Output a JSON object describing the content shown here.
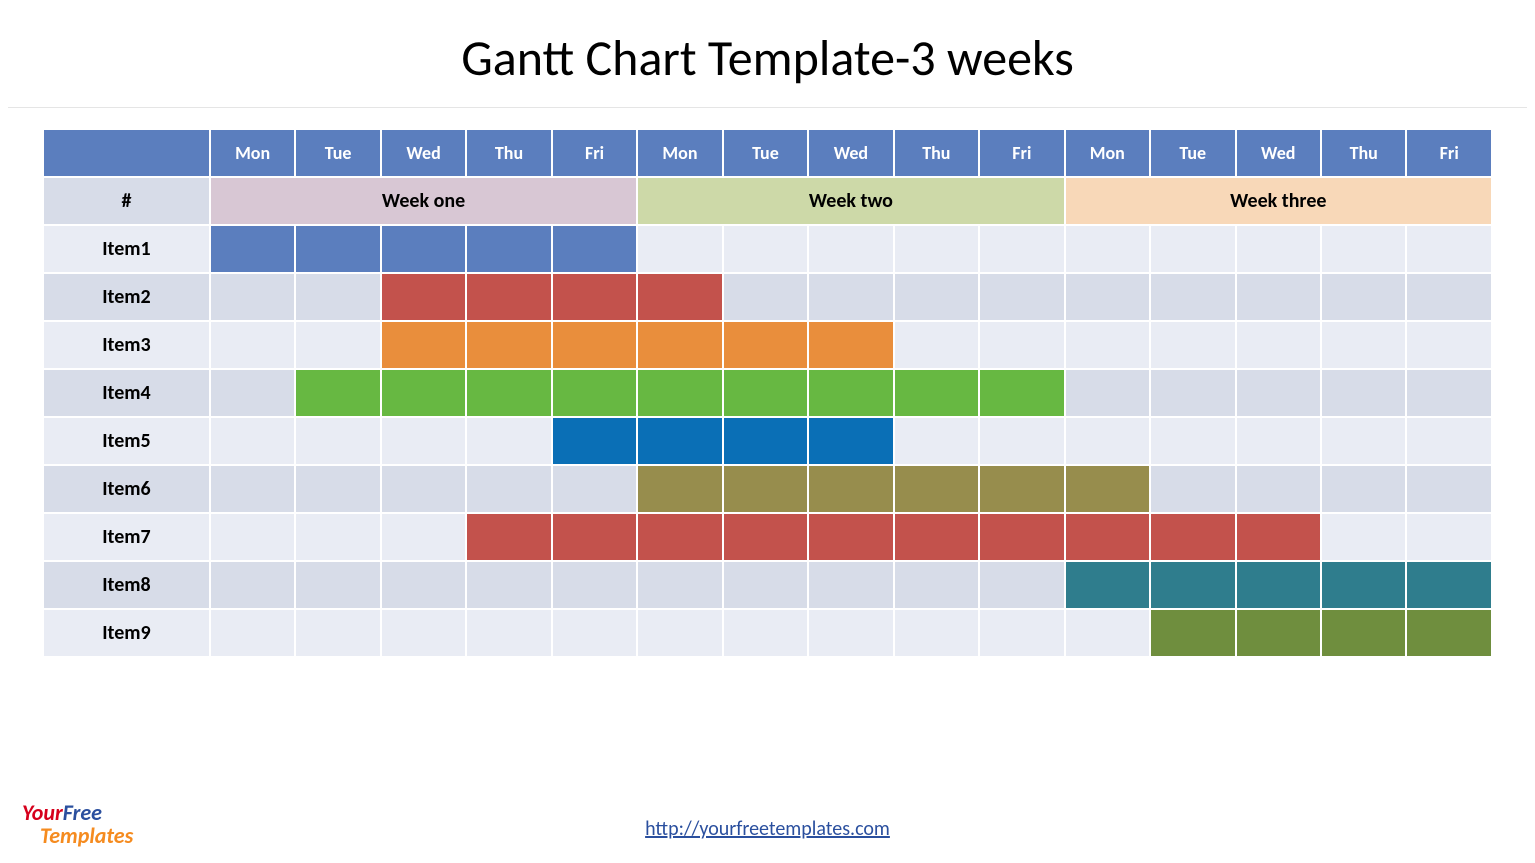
{
  "title": "Gantt Chart Template-3 weeks",
  "index_label": "#",
  "days": [
    "Mon",
    "Tue",
    "Wed",
    "Thu",
    "Fri",
    "Mon",
    "Tue",
    "Wed",
    "Thu",
    "Fri",
    "Mon",
    "Tue",
    "Wed",
    "Thu",
    "Fri"
  ],
  "weeks": [
    {
      "label": "Week one",
      "span": 5,
      "bg": "#d8c7d4"
    },
    {
      "label": "Week two",
      "span": 5,
      "bg": "#cdd9a8"
    },
    {
      "label": "Week three",
      "span": 5,
      "bg": "#f8d8b8"
    }
  ],
  "row_bg": {
    "label_odd": "#e9ecf4",
    "label_even": "#d7dce8",
    "cell_odd": "#e9ecf4",
    "cell_even": "#d7dce8"
  },
  "items": [
    {
      "label": "Item1",
      "start": 0,
      "end": 4,
      "color": "#5b7ebe"
    },
    {
      "label": "Item2",
      "start": 2,
      "end": 5,
      "color": "#c3524c"
    },
    {
      "label": "Item3",
      "start": 2,
      "end": 7,
      "color": "#e98e3c"
    },
    {
      "label": "Item4",
      "start": 1,
      "end": 9,
      "color": "#67b842"
    },
    {
      "label": "Item5",
      "start": 4,
      "end": 7,
      "color": "#0a6fb6"
    },
    {
      "label": "Item6",
      "start": 5,
      "end": 10,
      "color": "#978d4d"
    },
    {
      "label": "Item7",
      "start": 3,
      "end": 12,
      "color": "#c3524c"
    },
    {
      "label": "Item8",
      "start": 10,
      "end": 14,
      "color": "#2f7d8d"
    },
    {
      "label": "Item9",
      "start": 11,
      "end": 14,
      "color": "#6f8e3e"
    }
  ],
  "url_text": "http://yourfreetemplates.com",
  "logo": {
    "part1": "Your",
    "part2": "Free",
    "part3": "Templates"
  },
  "chart_data": {
    "type": "gantt",
    "title": "Gantt Chart Template-3 weeks",
    "categories": [
      "Mon",
      "Tue",
      "Wed",
      "Thu",
      "Fri",
      "Mon",
      "Tue",
      "Wed",
      "Thu",
      "Fri",
      "Mon",
      "Tue",
      "Wed",
      "Thu",
      "Fri"
    ],
    "groups": [
      {
        "label": "Week one",
        "range": [
          0,
          4
        ]
      },
      {
        "label": "Week two",
        "range": [
          5,
          9
        ]
      },
      {
        "label": "Week three",
        "range": [
          10,
          14
        ]
      }
    ],
    "series": [
      {
        "name": "Item1",
        "start": 0,
        "end": 4,
        "color": "#5b7ebe"
      },
      {
        "name": "Item2",
        "start": 2,
        "end": 5,
        "color": "#c3524c"
      },
      {
        "name": "Item3",
        "start": 2,
        "end": 7,
        "color": "#e98e3c"
      },
      {
        "name": "Item4",
        "start": 1,
        "end": 9,
        "color": "#67b842"
      },
      {
        "name": "Item5",
        "start": 4,
        "end": 7,
        "color": "#0a6fb6"
      },
      {
        "name": "Item6",
        "start": 5,
        "end": 10,
        "color": "#978d4d"
      },
      {
        "name": "Item7",
        "start": 3,
        "end": 12,
        "color": "#c3524c"
      },
      {
        "name": "Item8",
        "start": 10,
        "end": 14,
        "color": "#2f7d8d"
      },
      {
        "name": "Item9",
        "start": 11,
        "end": 14,
        "color": "#6f8e3e"
      }
    ],
    "xlabel": "",
    "ylabel": ""
  }
}
